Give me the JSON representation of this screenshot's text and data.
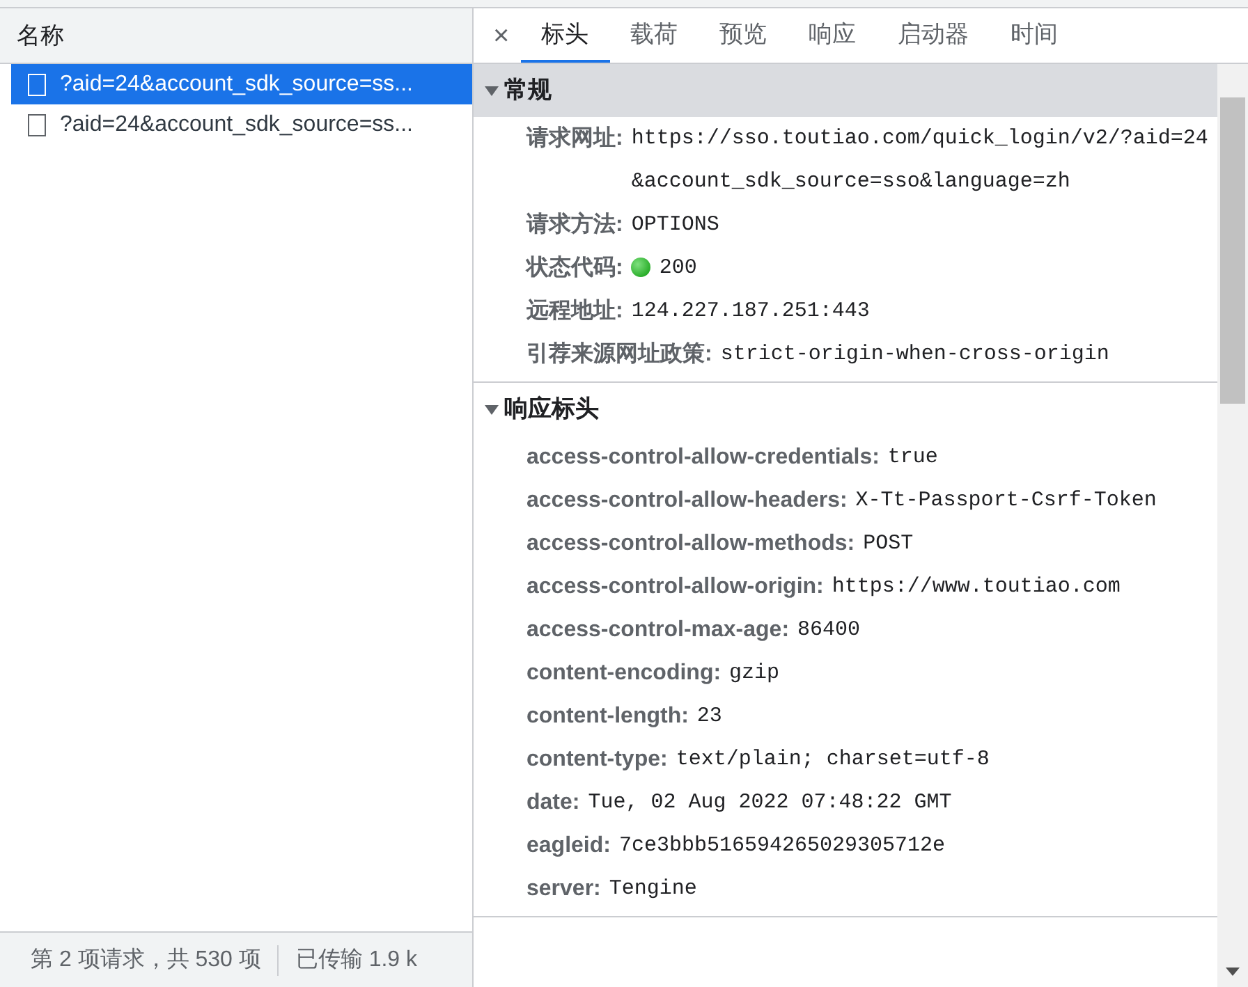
{
  "requests": {
    "column": "名称",
    "items": [
      {
        "label": "?aid=24&account_sdk_source=ss...",
        "selected": true
      },
      {
        "label": "?aid=24&account_sdk_source=ss...",
        "selected": false
      }
    ]
  },
  "status_bar": [
    "第 2 项请求，共 530 项",
    "已传输 1.9 k"
  ],
  "close": "×",
  "tabs": [
    {
      "label": "标头",
      "selected": true
    },
    {
      "label": "载荷",
      "selected": false
    },
    {
      "label": "预览",
      "selected": false
    },
    {
      "label": "响应",
      "selected": false
    },
    {
      "label": "启动器",
      "selected": false
    },
    {
      "label": "时间",
      "selected": false
    }
  ],
  "sections": [
    {
      "title": "常规",
      "expanded": true,
      "kind": "general",
      "rows": [
        {
          "kind": "text",
          "name": "请求网址:",
          "value": "https://sso.toutiao.com/quick_login/v2/?aid=24&account_sdk_source=sso&language=zh"
        },
        {
          "kind": "text",
          "name": "请求方法:",
          "value": "OPTIONS"
        },
        {
          "kind": "status",
          "name": "状态代码:",
          "value": "200"
        },
        {
          "kind": "text",
          "name": "远程地址:",
          "value": "124.227.187.251:443"
        },
        {
          "kind": "text",
          "name": "引荐来源网址政策:",
          "value": "strict-origin-when-cross-origin"
        }
      ]
    },
    {
      "title": "响应标头",
      "expanded": true,
      "kind": "headers",
      "rows": [
        {
          "kind": "text",
          "name": "access-control-allow-credentials:",
          "value": "true"
        },
        {
          "kind": "text",
          "name": "access-control-allow-headers:",
          "value": "X-Tt-Passport-Csrf-Token"
        },
        {
          "kind": "text",
          "name": "access-control-allow-methods:",
          "value": "POST"
        },
        {
          "kind": "text",
          "name": "access-control-allow-origin:",
          "value": "https://www.toutiao.com"
        },
        {
          "kind": "text",
          "name": "access-control-max-age:",
          "value": "86400"
        },
        {
          "kind": "text",
          "name": "content-encoding:",
          "value": "gzip"
        },
        {
          "kind": "text",
          "name": "content-length:",
          "value": "23"
        },
        {
          "kind": "text",
          "name": "content-type:",
          "value": "text/plain; charset=utf-8"
        },
        {
          "kind": "text",
          "name": "date:",
          "value": "Tue, 02 Aug 2022 07:48:22 GMT"
        },
        {
          "kind": "text",
          "name": "eagleid:",
          "value": "7ce3bbb516594265029305712e"
        },
        {
          "kind": "text",
          "name": "server:",
          "value": "Tengine"
        }
      ]
    }
  ]
}
